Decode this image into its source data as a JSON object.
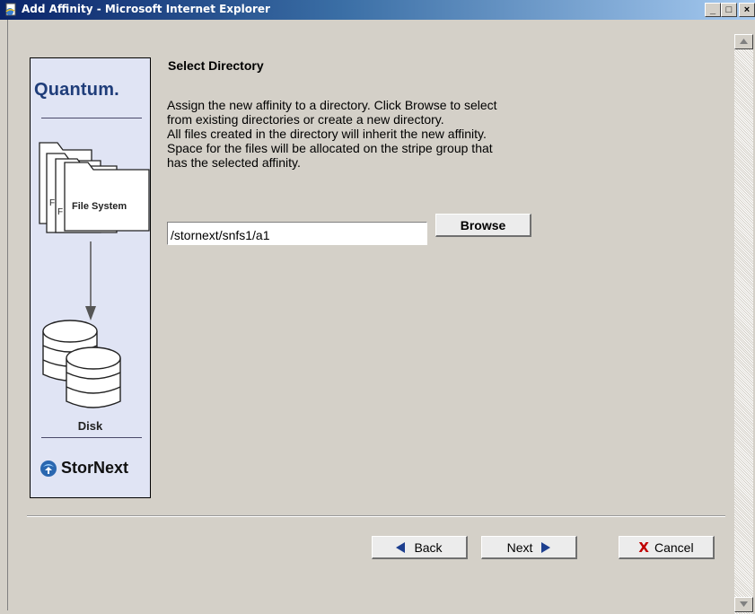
{
  "window": {
    "title": "Add Affinity - Microsoft Internet Explorer",
    "icon": "ie-page-icon",
    "controls": [
      "minimize",
      "maximize",
      "close"
    ]
  },
  "sidebar": {
    "brand": "Quantum.",
    "folder_label": "File System",
    "disk_label": "Disk",
    "product": "StorNext"
  },
  "main": {
    "heading": "Select Directory",
    "description_lines": [
      "Assign the new affinity to a directory. Click Browse to select",
      "from existing directories or create a new directory.",
      "All files created in the directory will inherit the new affinity.",
      "Space for the files will be allocated on the stripe group that",
      "has the selected affinity."
    ],
    "directory_value": "/stornext/snfs1/a1",
    "browse_label": "Browse"
  },
  "footer": {
    "back_label": "Back",
    "next_label": "Next",
    "cancel_label": "Cancel"
  },
  "colors": {
    "titlebar_start": "#0a246a",
    "titlebar_end": "#a6caf0",
    "sidebar_bg": "#e0e4f4",
    "cancel_x": "#c00000",
    "arrow": "#1d3f8f"
  }
}
